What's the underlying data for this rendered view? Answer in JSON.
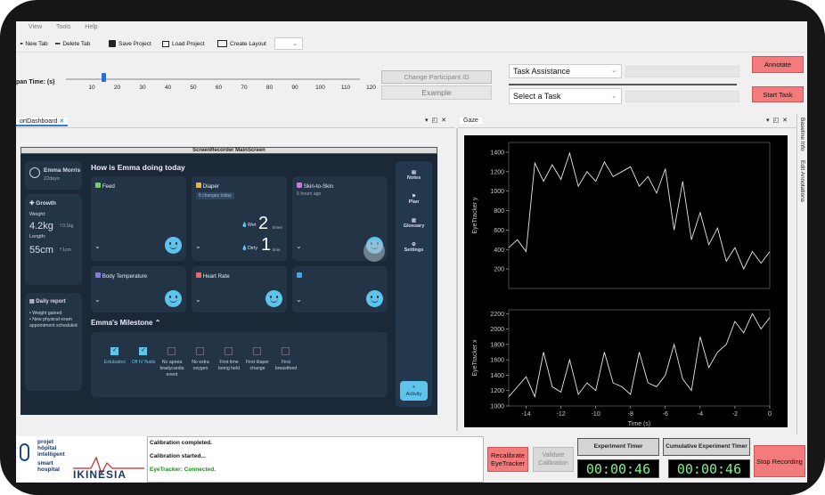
{
  "menu": {
    "items": [
      "View",
      "Tools",
      "Help"
    ]
  },
  "toolbar": {
    "new_tab": "New Tab",
    "delete_tab": "Delete Tab",
    "save_project": "Save Project",
    "load_project": "Load Project",
    "create_layout": "Create Layout"
  },
  "timespan": {
    "label": "pan Time: (s)",
    "ticks": [
      "10",
      "20",
      "30",
      "40",
      "50",
      "60",
      "70",
      "80",
      "90",
      "100",
      "110",
      "120"
    ],
    "value_s": 15
  },
  "participant": {
    "change_button": "Change Participant ID",
    "name": "Example"
  },
  "task": {
    "assistance_combo": "Task Assistance",
    "select_combo": "Select a Task",
    "annotate": "Annotate",
    "start_task": "Start Task"
  },
  "dashboard_tab": {
    "title": "ortDashboard",
    "screen_title": "ScreenRecorder MainScreen"
  },
  "patient": {
    "name": "Emma Morris",
    "age": "22days"
  },
  "growth": {
    "title": "Growth",
    "weight_label": "Weight:",
    "weight": "4.2kg",
    "weight_delta": "0.1kg",
    "length_label": "Length:",
    "length": "55cm",
    "length_delta": "1cm"
  },
  "report": {
    "title": "Daily report",
    "items": [
      "Weight gained",
      "New physical exam appointment scheduled"
    ]
  },
  "dashboard": {
    "heading": "How is Emma doing today",
    "feed": "Feed",
    "diaper": {
      "title": "Diaper",
      "badge": "5 changes today",
      "wet_label": "Wet",
      "wet_count": "2",
      "dirty_label": "Dirty",
      "dirty_count": "1",
      "wet_unit": "times",
      "dirty_unit": "time"
    },
    "skin": {
      "title": "Skin-to-Skin",
      "sub": "5 hours ago"
    },
    "body_temp": "Body Temperature",
    "heart_rate": "Heart Rate",
    "milestone_title": "Emma's Milestone",
    "milestones": [
      {
        "label": "Extubation",
        "checked": true
      },
      {
        "label": "Off IV fluids",
        "checked": true
      },
      {
        "label": "No apnea bradycardia event",
        "checked": false
      },
      {
        "label": "No extra oxygen",
        "checked": false
      },
      {
        "label": "First time being held",
        "checked": false
      },
      {
        "label": "First diaper change",
        "checked": false
      },
      {
        "label": "First breastfeed",
        "checked": false
      }
    ],
    "side": {
      "notes": "Notes",
      "plan": "Plan",
      "glossary": "Glossary",
      "settings": "Settings",
      "activity": "Activity"
    }
  },
  "gaze": {
    "title": "Gaze"
  },
  "side_tabs": {
    "baseline": "Baseline Info",
    "edit": "Edit Annotations"
  },
  "chart_data": [
    {
      "type": "line",
      "ylabel": "EyeTracker y",
      "ylim": [
        0,
        1500
      ],
      "yticks": [
        200,
        400,
        600,
        800,
        1000,
        1200,
        1400
      ],
      "x": [
        -15,
        -14.5,
        -14,
        -13.5,
        -13,
        -12.5,
        -12,
        -11.5,
        -11,
        -10.5,
        -10,
        -9.5,
        -9,
        -8.5,
        -8,
        -7.5,
        -7,
        -6.5,
        -6,
        -5.5,
        -5,
        -4.5,
        -4,
        -3.5,
        -3,
        -2.5,
        -2,
        -1.5,
        -1,
        -0.5,
        0
      ],
      "values": [
        420,
        500,
        380,
        1290,
        1100,
        1270,
        1120,
        1390,
        1050,
        1200,
        1100,
        1300,
        1150,
        1200,
        1250,
        1050,
        1150,
        980,
        1230,
        600,
        1100,
        500,
        780,
        450,
        620,
        280,
        420,
        200,
        380,
        260,
        380
      ]
    },
    {
      "type": "line",
      "ylabel": "EyeTracker x",
      "xlabel": "Time (s)",
      "ylim": [
        1000,
        2250
      ],
      "yticks": [
        1000,
        1200,
        1400,
        1600,
        1800,
        2000,
        2200
      ],
      "xticks": [
        -14,
        -12,
        -10,
        -8,
        -6,
        -4,
        -2,
        0
      ],
      "x": [
        -15,
        -14.5,
        -14,
        -13.5,
        -13,
        -12.5,
        -12,
        -11.5,
        -11,
        -10.5,
        -10,
        -9.5,
        -9,
        -8.5,
        -8,
        -7.5,
        -7,
        -6.5,
        -6,
        -5.5,
        -5,
        -4.5,
        -4,
        -3.5,
        -3,
        -2.5,
        -2,
        -1.5,
        -1,
        -0.5,
        0
      ],
      "values": [
        1120,
        1250,
        1380,
        1120,
        1700,
        1250,
        1180,
        1600,
        1150,
        1300,
        1200,
        1700,
        1300,
        1250,
        1150,
        1700,
        1300,
        1250,
        1400,
        1800,
        1350,
        1200,
        1900,
        1500,
        1700,
        1800,
        2100,
        1950,
        2200,
        2000,
        2150
      ]
    }
  ],
  "log": {
    "lines": [
      {
        "text": "Calibration completed.",
        "color": "#111111"
      },
      {
        "text": "Calibration started...",
        "color": "#111111"
      },
      {
        "text": "EyeTracker: Connected.",
        "color": "#1c8a1c"
      }
    ]
  },
  "logo": {
    "line1": "projet",
    "line2": "hôpital",
    "line3": "intelligent",
    "line4": "smart",
    "line5": "hospital",
    "brand": "IKINESIA"
  },
  "controls": {
    "recalibrate": "Recalibrate EyeTracker",
    "validate": "Validate Calibration",
    "experiment_timer": "Experiment Timer",
    "cumulative_timer": "Cumulative Experiment Timer",
    "timer1": "00:00:46",
    "timer2": "00:00:46",
    "stop": "Stop Recording"
  },
  "colors": {
    "accent_pink": "#f47b7b",
    "dash_bg": "#1b2838",
    "card_bg": "#233447",
    "smile_blue": "#5fc4ec",
    "timer_green": "#7ff08a"
  }
}
